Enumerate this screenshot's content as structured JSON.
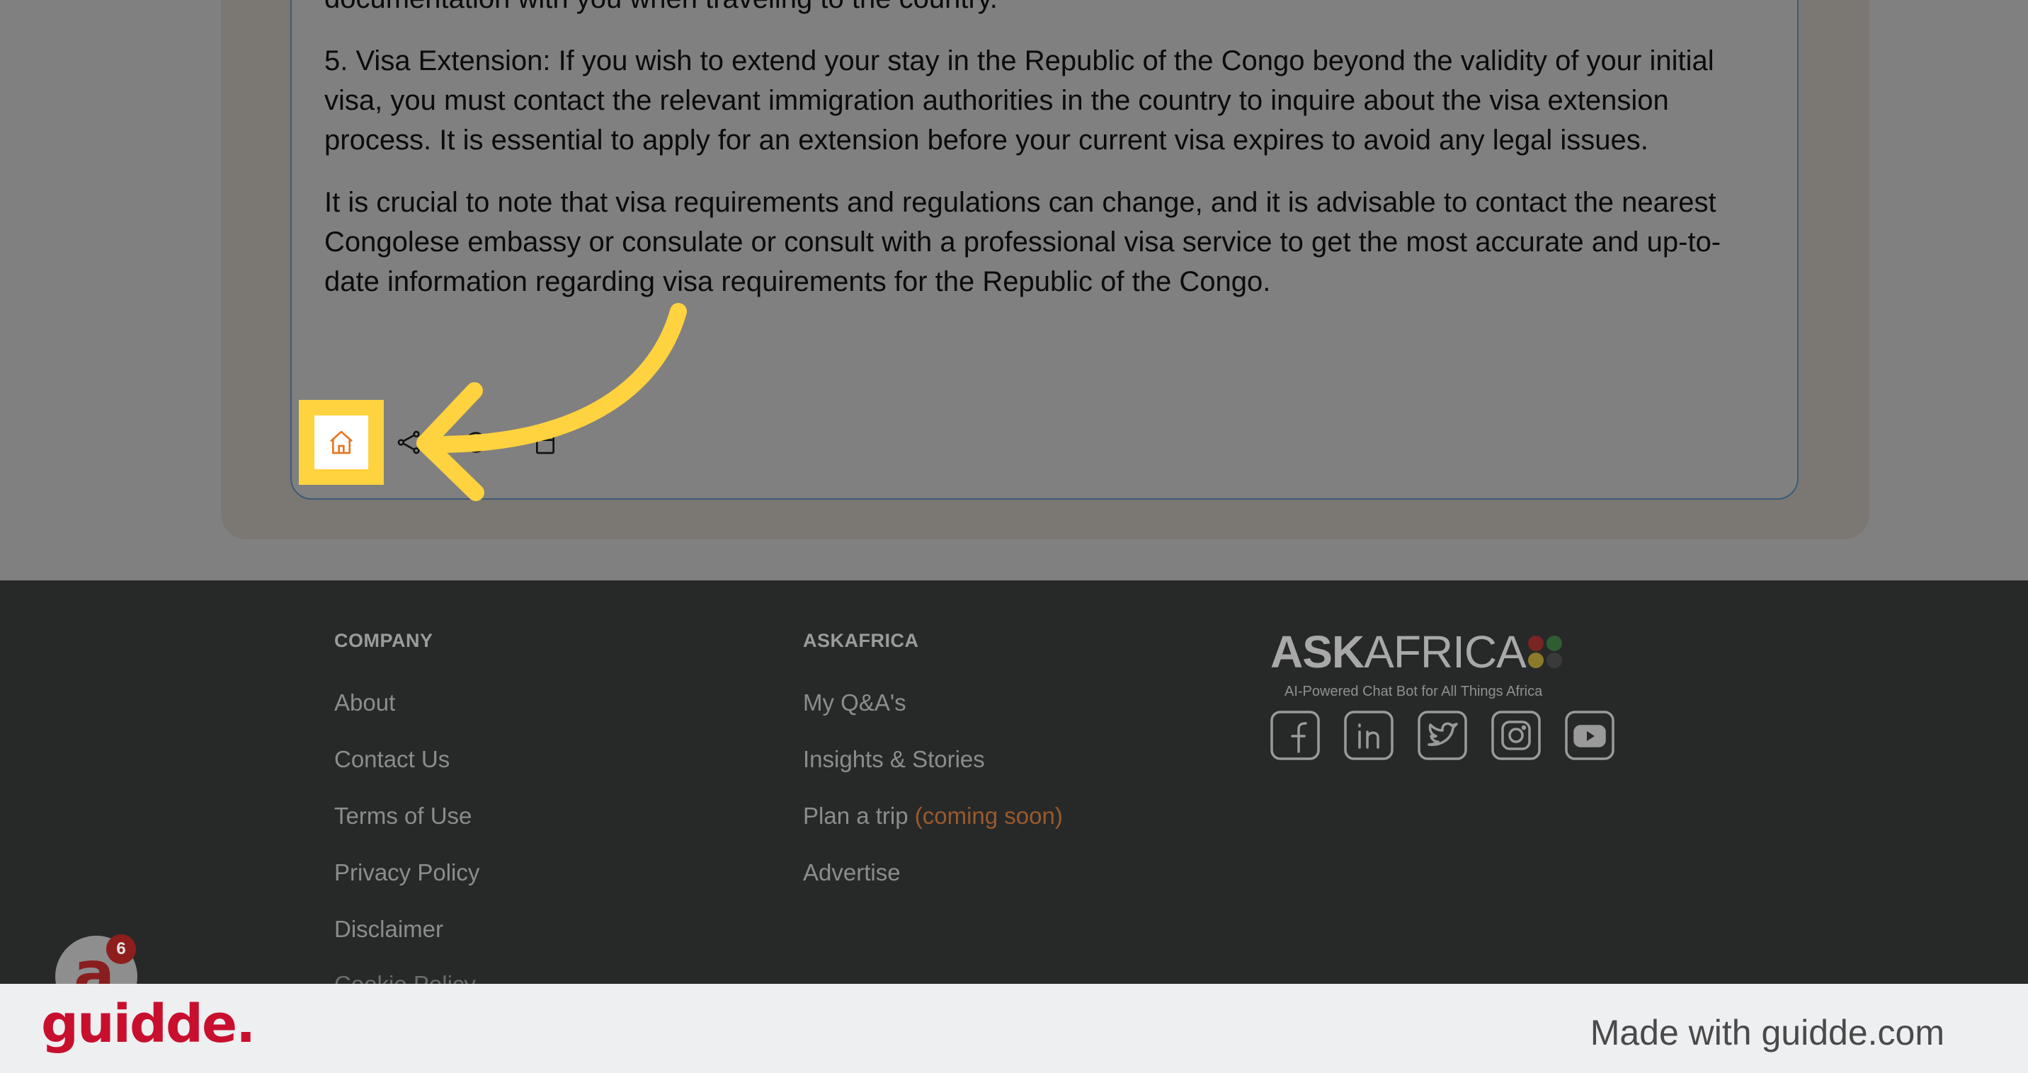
{
  "answer": {
    "paragraph_partial": "documentation with you when traveling to the country.",
    "paragraph_visa_extension": "5. Visa Extension: If you wish to extend your stay in the Republic of the Congo beyond the validity of your initial visa, you must contact the relevant immigration authorities in the country to inquire about the visa extension process. It is essential to apply for an extension before your current visa expires to avoid any legal issues.",
    "paragraph_note": "It is crucial to note that visa requirements and regulations can change, and it is advisable to contact the nearest Congolese embassy or consulate or consult with a professional visa service to get the most accurate and up-to-date information regarding visa requirements for the Republic of the Congo."
  },
  "actions": {
    "icons": [
      "home-icon",
      "share-icon",
      "comment-icon",
      "copy-icon"
    ]
  },
  "colors": {
    "highlight": "#ffd23f",
    "arrow": "#ffd23f",
    "home_icon": "#e87722",
    "footer_bg": "#272929",
    "guidde_red": "#c8102e"
  },
  "footer": {
    "company": {
      "title": "COMPANY",
      "links": [
        "About",
        "Contact Us",
        "Terms of Use",
        "Privacy Policy",
        "Disclaimer"
      ],
      "cutoff_link": "Cookie Policy"
    },
    "askafrica": {
      "title": "ASKAFRICA",
      "links": [
        "My Q&A's",
        "Insights & Stories",
        "Plan a trip",
        "Advertise"
      ],
      "coming_soon": "(coming soon)"
    },
    "brand": {
      "name_bold": "ASK",
      "name_light": "AFRICA",
      "tagline": "AI-Powered Chat Bot for All Things Africa"
    },
    "social_icons": [
      "facebook-icon",
      "linkedin-icon",
      "twitter-icon",
      "instagram-icon",
      "youtube-icon"
    ]
  },
  "chat_widget": {
    "letter": "a",
    "badge_count": "6"
  },
  "guidde": {
    "logo": "guidde.",
    "made_with": "Made with guidde.com"
  }
}
